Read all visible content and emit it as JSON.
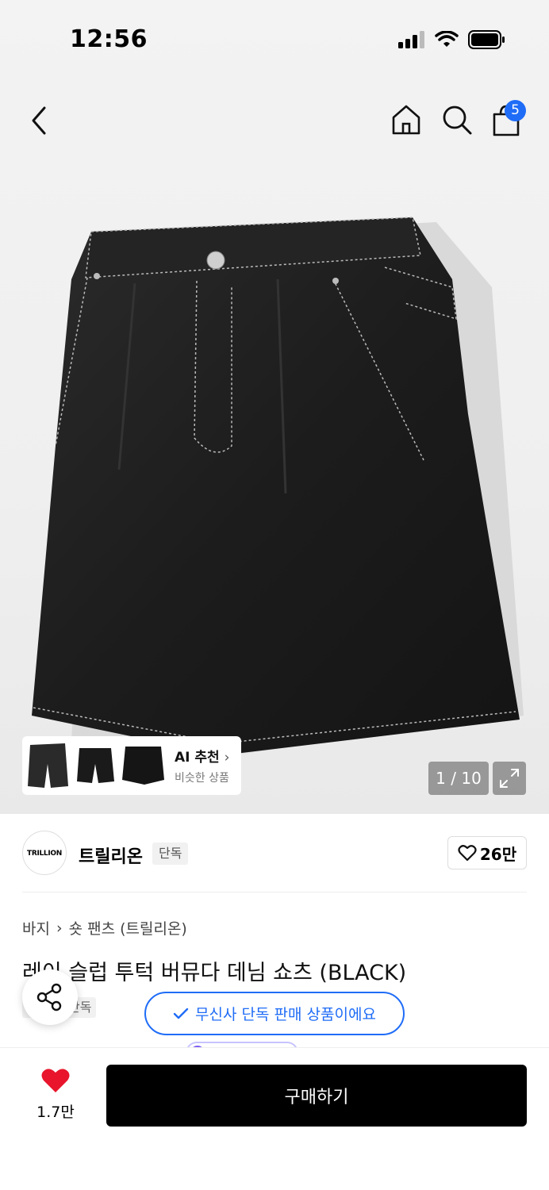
{
  "status_bar": {
    "time": "12:56"
  },
  "nav": {
    "cart_count": "5"
  },
  "gallery": {
    "ai_title": "AI 추천",
    "ai_subtitle": "비슷한 상품",
    "pager": "1 / 10"
  },
  "brand": {
    "logo_text": "TRILLION",
    "name": "트릴리온",
    "badge": "단독",
    "likes": "26만"
  },
  "breadcrumb": [
    "바지",
    "숏 팬츠 (트릴리온)"
  ],
  "product": {
    "title": "레이 슬럽 투턱 버뮤다 데님 쇼츠 (BLACK)",
    "badge": "단독",
    "exclusive_notice": "무신사 단독 판매 상품이에요"
  },
  "bottom_bar": {
    "wish_count": "1.7만",
    "buy_label": "구매하기"
  },
  "colors": {
    "accent": "#1f6cf7",
    "wish": "#e8152c",
    "buy_bg": "#000000"
  }
}
